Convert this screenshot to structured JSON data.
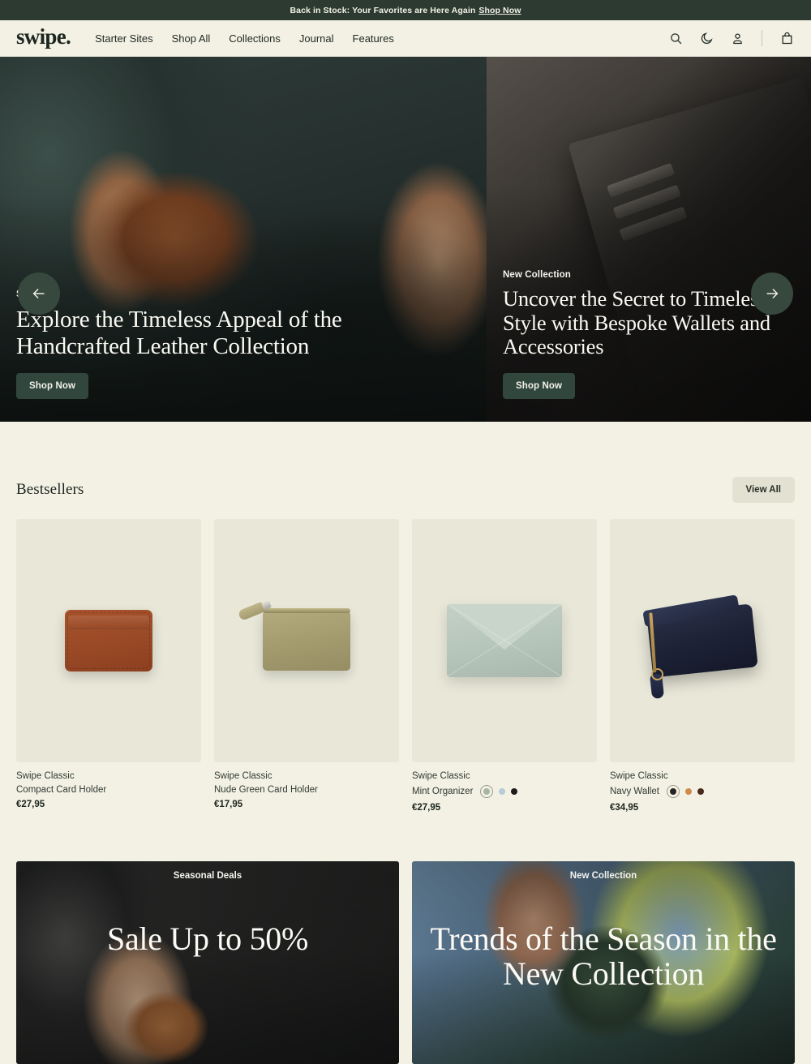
{
  "announcement": {
    "text": "Back in Stock: Your Favorites are Here Again",
    "link_label": "Shop Now"
  },
  "header": {
    "logo": "swipe.",
    "nav": [
      {
        "label": "Starter Sites"
      },
      {
        "label": "Shop All"
      },
      {
        "label": "Collections"
      },
      {
        "label": "Journal"
      },
      {
        "label": "Features"
      }
    ],
    "icons": [
      {
        "name": "search-icon"
      },
      {
        "name": "moon-icon"
      },
      {
        "name": "account-icon"
      },
      {
        "name": "cart-icon"
      }
    ]
  },
  "hero": {
    "prev_label": "Previous slide",
    "next_label": "Next slide",
    "slides": [
      {
        "eyebrow": "Sale",
        "title": "Explore the Timeless Appeal of the Handcrafted Leather Collection",
        "cta": "Shop Now"
      },
      {
        "eyebrow": "New Collection",
        "title": "Uncover the Secret to Timeless Style with Bespoke Wallets and Accessories",
        "cta": "Shop Now"
      }
    ]
  },
  "bestsellers": {
    "title": "Bestsellers",
    "view_all": "View All",
    "products": [
      {
        "brand": "Swipe Classic",
        "name": "Compact Card Holder",
        "price": "€27,95",
        "swatches": []
      },
      {
        "brand": "Swipe Classic",
        "name": "Nude Green Card Holder",
        "price": "€17,95",
        "swatches": []
      },
      {
        "brand": "Swipe Classic",
        "name": "Mint Organizer",
        "price": "€27,95",
        "swatches": [
          {
            "color": "#a7b5a6",
            "selected": true
          },
          {
            "color": "#b7cbd8",
            "selected": false
          },
          {
            "color": "#1c1c1c",
            "selected": false
          }
        ]
      },
      {
        "brand": "Swipe Classic",
        "name": "Navy Wallet",
        "price": "€34,95",
        "swatches": [
          {
            "color": "#262424",
            "selected": true
          },
          {
            "color": "#d08a4e",
            "selected": false
          },
          {
            "color": "#4a2a1c",
            "selected": false
          }
        ]
      }
    ]
  },
  "promos": [
    {
      "eyebrow": "Seasonal Deals",
      "title": "Sale Up to 50%"
    },
    {
      "eyebrow": "New Collection",
      "title": "Trends of the Season in the New Collection"
    }
  ],
  "colors": {
    "page_bg": "#f2f1e4",
    "dark_green": "#2c3a32",
    "button_green": "#31463c",
    "tile_bg": "#e8e7d8",
    "view_all_bg": "#e2e1d2"
  }
}
